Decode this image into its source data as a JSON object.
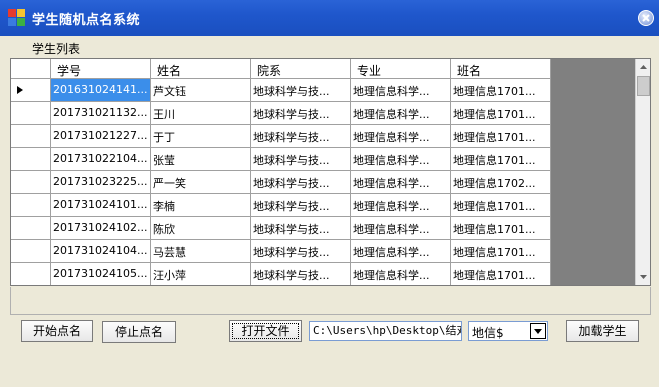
{
  "window": {
    "title": "学生随机点名系统"
  },
  "group": {
    "label": "学生列表"
  },
  "table": {
    "columns": [
      "学号",
      "姓名",
      "院系",
      "专业",
      "班名"
    ],
    "rows": [
      [
        "201631024141...",
        "芦文钰",
        "地球科学与技...",
        "地理信息科学...",
        "地理信息1701..."
      ],
      [
        "201731021132...",
        "王川",
        "地球科学与技...",
        "地理信息科学...",
        "地理信息1701..."
      ],
      [
        "201731021227...",
        "于丁",
        "地球科学与技...",
        "地理信息科学...",
        "地理信息1701..."
      ],
      [
        "201731022104...",
        "张莹",
        "地球科学与技...",
        "地理信息科学...",
        "地理信息1701..."
      ],
      [
        "201731023225...",
        "严一笑",
        "地球科学与技...",
        "地理信息科学...",
        "地理信息1702..."
      ],
      [
        "201731024101...",
        "李楠",
        "地球科学与技...",
        "地理信息科学...",
        "地理信息1701..."
      ],
      [
        "201731024102...",
        "陈欣",
        "地球科学与技...",
        "地理信息科学...",
        "地理信息1701..."
      ],
      [
        "201731024104...",
        "马芸慧",
        "地球科学与技...",
        "地理信息科学...",
        "地理信息1701..."
      ],
      [
        "201731024105...",
        "汪小萍",
        "地球科学与技...",
        "地理信息科学...",
        "地理信息1701..."
      ]
    ]
  },
  "buttons": {
    "start": "开始点名",
    "stop": "停止点名",
    "open_file": "打开文件",
    "load": "加载学生"
  },
  "path": {
    "value": "C:\\Users\\hp\\Desktop\\结对编"
  },
  "sheet_select": {
    "value": "地信$"
  },
  "colors": {
    "title_bar": "#1f57cc",
    "selection": "#3b8eea",
    "grid_bg": "#808080"
  }
}
